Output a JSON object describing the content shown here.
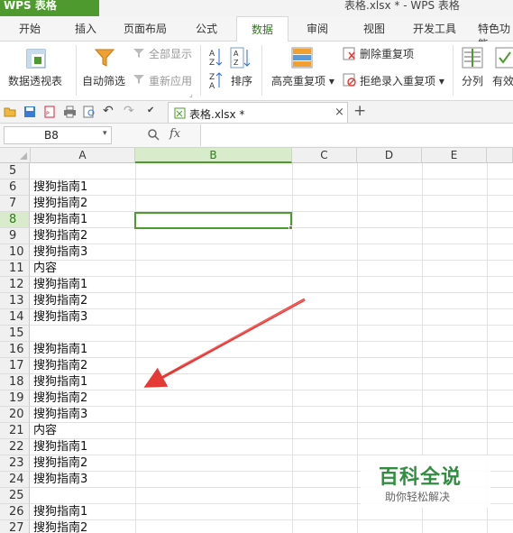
{
  "app": {
    "name": "WPS 表格",
    "window_title": "表格.xlsx * - WPS 表格"
  },
  "menu": {
    "items": [
      "开始",
      "插入",
      "页面布局",
      "公式",
      "数据",
      "审阅",
      "视图",
      "开发工具",
      "特色功能"
    ],
    "active": "数据"
  },
  "ribbon": {
    "pivot_label": "数据透视表",
    "autofilter_label": "自动筛选",
    "show_all_label": "全部显示",
    "reapply_label": "重新应用",
    "sort_label": "排序",
    "highlight_dup_label": "高亮重复项",
    "remove_dup_label": "删除重复项",
    "reject_dup_label": "拒绝录入重复项",
    "split_label": "分列",
    "valid_label": "有效"
  },
  "doc_tab": {
    "label": "表格.xlsx *",
    "close": "×",
    "add": "+"
  },
  "formula": {
    "name_box": "B8",
    "name_arrow": "▾",
    "fx": "fx",
    "value": ""
  },
  "columns": [
    "A",
    "B",
    "C",
    "D",
    "E"
  ],
  "selected_column": "B",
  "selected_row": "8",
  "rows": [
    {
      "num": "5",
      "a": ""
    },
    {
      "num": "6",
      "a": "搜狗指南1"
    },
    {
      "num": "7",
      "a": "搜狗指南2"
    },
    {
      "num": "8",
      "a": "搜狗指南1"
    },
    {
      "num": "9",
      "a": "搜狗指南2"
    },
    {
      "num": "10",
      "a": "搜狗指南3"
    },
    {
      "num": "11",
      "a": "内容"
    },
    {
      "num": "12",
      "a": "搜狗指南1"
    },
    {
      "num": "13",
      "a": "搜狗指南2"
    },
    {
      "num": "14",
      "a": "搜狗指南3"
    },
    {
      "num": "15",
      "a": ""
    },
    {
      "num": "16",
      "a": "搜狗指南1"
    },
    {
      "num": "17",
      "a": "搜狗指南2"
    },
    {
      "num": "18",
      "a": "搜狗指南1"
    },
    {
      "num": "19",
      "a": "搜狗指南2"
    },
    {
      "num": "20",
      "a": "搜狗指南3"
    },
    {
      "num": "21",
      "a": "内容"
    },
    {
      "num": "22",
      "a": "搜狗指南1"
    },
    {
      "num": "23",
      "a": "搜狗指南2"
    },
    {
      "num": "24",
      "a": "搜狗指南3"
    },
    {
      "num": "25",
      "a": ""
    },
    {
      "num": "26",
      "a": "搜狗指南1"
    },
    {
      "num": "27",
      "a": "搜狗指南2"
    }
  ],
  "watermark": {
    "title": "百科全说",
    "subtitle": "助你轻松解决"
  },
  "colors": {
    "accent": "#4e9a2e",
    "arrow": "#e53935"
  }
}
